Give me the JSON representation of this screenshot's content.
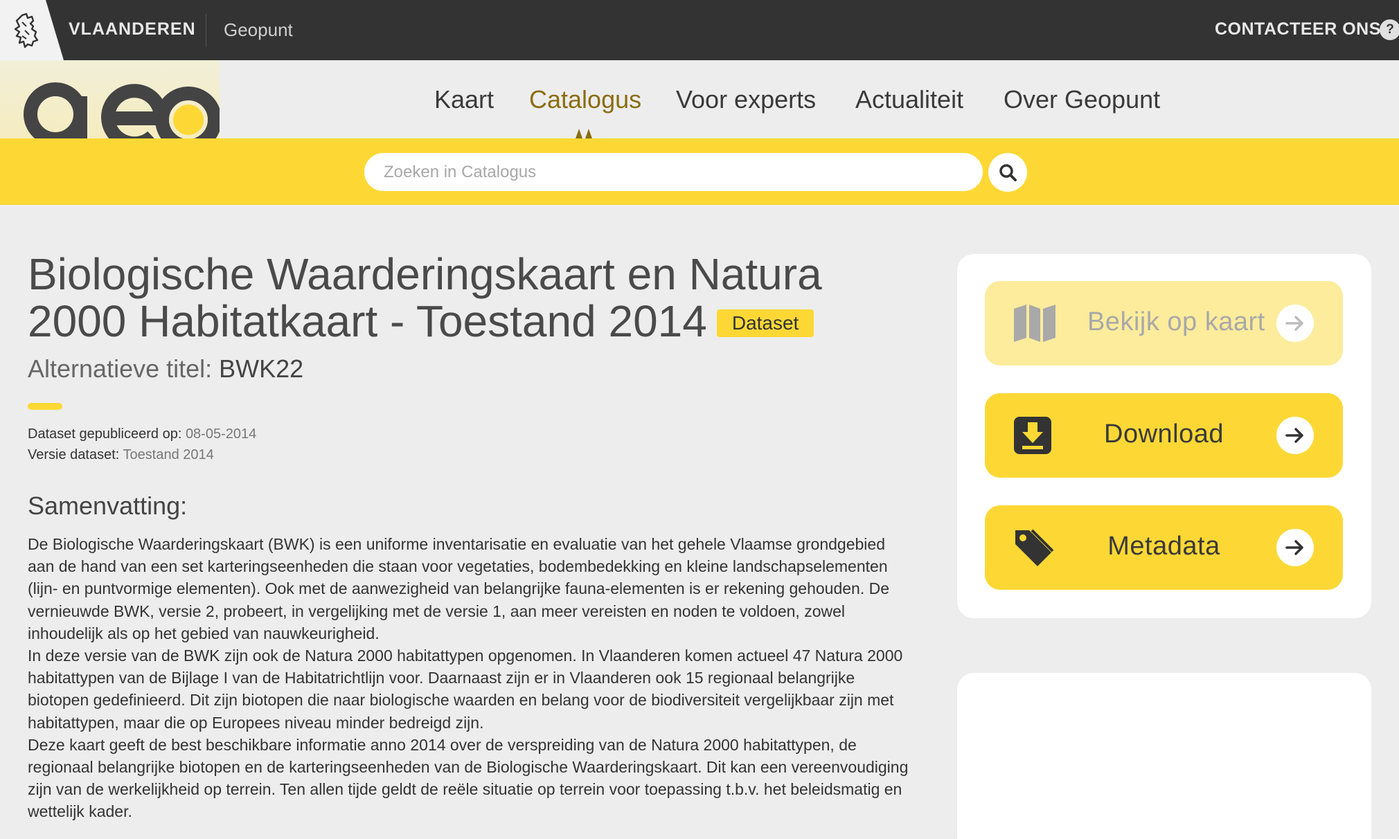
{
  "topbar": {
    "region_label": "VLAANDEREN",
    "site_label": "Geopunt",
    "contact_label": "CONTACTEER ONS",
    "help_label": "?"
  },
  "logo": {
    "text": "geo"
  },
  "nav": {
    "items": [
      {
        "label": "Kaart"
      },
      {
        "label": "Catalogus",
        "active": true
      },
      {
        "label": "Voor experts"
      },
      {
        "label": "Actualiteit"
      },
      {
        "label": "Over Geopunt"
      }
    ]
  },
  "search": {
    "placeholder": "Zoeken in Catalogus",
    "value": ""
  },
  "dataset": {
    "title": "Biologische Waarderingskaart en Natura 2000 Habitatkaart - Toestand 2014",
    "badge": "Dataset",
    "alt_title_label": "Alternatieve titel:",
    "alt_title_value": "BWK22",
    "published_label": "Dataset gepubliceerd op:",
    "published_value": "08-05-2014",
    "version_label": "Versie dataset:",
    "version_value": "Toestand 2014",
    "summary_heading": "Samenvatting:",
    "summary_paragraphs": [
      "De Biologische Waarderingskaart (BWK) is een uniforme inventarisatie en evaluatie van het gehele Vlaamse grondgebied aan de hand van een set karteringseenheden die staan voor vegetaties, bodembedekking en kleine landschapselementen (lijn- en puntvormige elementen). Ook met de aanwezigheid van belangrijke fauna-elementen is er rekening gehouden. De vernieuwde BWK, versie 2, probeert, in vergelijking met de versie 1, aan meer vereisten en noden te voldoen, zowel inhoudelijk als op het gebied van nauwkeurigheid.",
      "In deze versie van de BWK zijn ook de Natura 2000 habitattypen opgenomen. In Vlaanderen komen actueel 47 Natura 2000 habitattypen van de Bijlage I van de Habitatrichtlijn voor. Daarnaast zijn er in Vlaanderen ook 15 regionaal belangrijke biotopen gedefinieerd. Dit zijn biotopen die naar biologische waarden en belang voor de biodiversiteit vergelijkbaar zijn met habitattypen, maar die op Europees niveau minder bedreigd zijn.",
      "Deze kaart geeft de best beschikbare informatie anno 2014 over de verspreiding van de Natura 2000 habitattypen, de regionaal belangrijke biotopen en de karteringseenheden van de Biologische Waarderingskaart. Dit kan een vereenvoudiging zijn van de werkelijkheid op terrein. Ten allen tijde geldt de reële situatie op terrein voor toepassing t.b.v. het beleidsmatig en wettelijk kader."
    ]
  },
  "actions": {
    "view_map": {
      "label": "Bekijk op kaart",
      "icon": "map-icon",
      "enabled": false
    },
    "download": {
      "label": "Download",
      "icon": "download-icon",
      "enabled": true
    },
    "metadata": {
      "label": "Metadata",
      "icon": "tag-icon",
      "enabled": true
    }
  },
  "colors": {
    "accent_yellow": "#fdd835",
    "topbar_dark": "#333333",
    "active_nav": "#8a6d10",
    "background": "#ededed"
  }
}
